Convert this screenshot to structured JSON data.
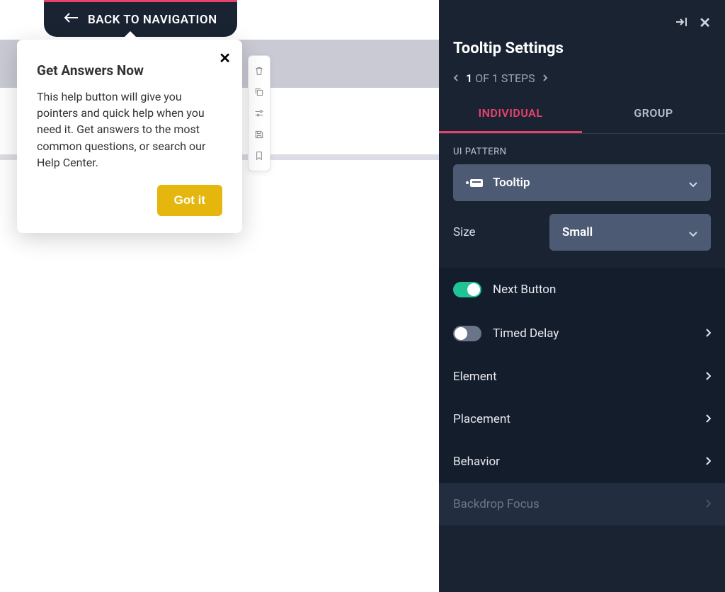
{
  "back_button": {
    "label": "BACK TO NAVIGATION"
  },
  "tooltip": {
    "title": "Get Answers Now",
    "body": "This help button will give you pointers and quick help when you need it. Get answers to the most common questions, or search our Help Center.",
    "cta": "Got it"
  },
  "panel": {
    "title": "Tooltip Settings",
    "steps": {
      "current": "1",
      "total_label": "OF 1 STEPS"
    },
    "tabs": {
      "individual": "INDIVIDUAL",
      "group": "GROUP"
    },
    "ui_pattern_label": "UI PATTERN",
    "ui_pattern_value": "Tooltip",
    "size_label": "Size",
    "size_value": "Small",
    "toggles": {
      "next_button": "Next Button",
      "timed_delay": "Timed Delay"
    },
    "rows": {
      "element": "Element",
      "placement": "Placement",
      "behavior": "Behavior",
      "backdrop": "Backdrop Focus"
    }
  }
}
